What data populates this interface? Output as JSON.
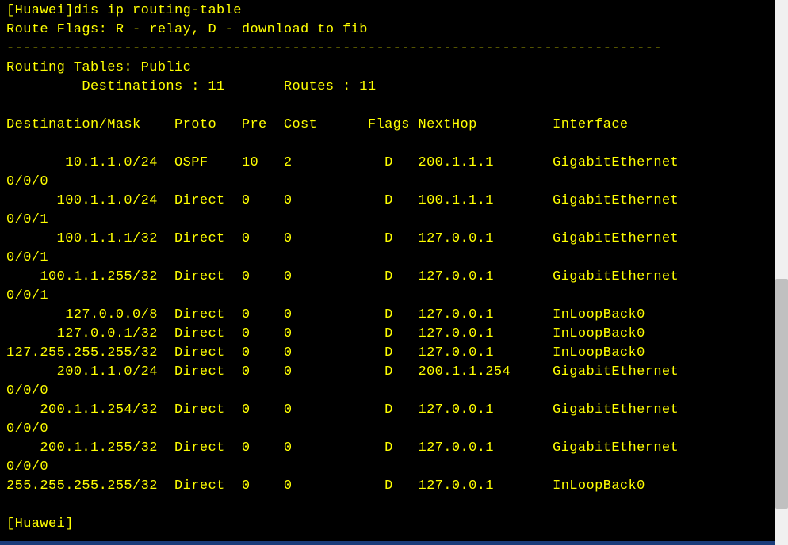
{
  "prompt_host": "[Huawei]",
  "command": "dis ip routing-table",
  "route_flags": "Route Flags: R - relay, D - download to fib",
  "separator": "------------------------------------------------------------------------------",
  "table_name": "Routing Tables: Public",
  "summary": {
    "destinations_label": "Destinations :",
    "destinations_value": "11",
    "routes_label": "Routes :",
    "routes_value": "11"
  },
  "headers": {
    "destmask": "Destination/Mask",
    "proto": "Proto",
    "pre": "Pre",
    "cost": "Cost",
    "flags": "Flags",
    "nexthop": "NextHop",
    "interface": "Interface"
  },
  "routes": [
    {
      "dest": "10.1.1.0/24",
      "proto": "OSPF",
      "pre": "10",
      "cost": "2",
      "flags": "D",
      "nexthop": "200.1.1.1",
      "iface": "GigabitEthernet",
      "iface2": "0/0/0"
    },
    {
      "dest": "100.1.1.0/24",
      "proto": "Direct",
      "pre": "0",
      "cost": "0",
      "flags": "D",
      "nexthop": "100.1.1.1",
      "iface": "GigabitEthernet",
      "iface2": "0/0/1"
    },
    {
      "dest": "100.1.1.1/32",
      "proto": "Direct",
      "pre": "0",
      "cost": "0",
      "flags": "D",
      "nexthop": "127.0.0.1",
      "iface": "GigabitEthernet",
      "iface2": "0/0/1"
    },
    {
      "dest": "100.1.1.255/32",
      "proto": "Direct",
      "pre": "0",
      "cost": "0",
      "flags": "D",
      "nexthop": "127.0.0.1",
      "iface": "GigabitEthernet",
      "iface2": "0/0/1"
    },
    {
      "dest": "127.0.0.0/8",
      "proto": "Direct",
      "pre": "0",
      "cost": "0",
      "flags": "D",
      "nexthop": "127.0.0.1",
      "iface": "InLoopBack0",
      "iface2": ""
    },
    {
      "dest": "127.0.0.1/32",
      "proto": "Direct",
      "pre": "0",
      "cost": "0",
      "flags": "D",
      "nexthop": "127.0.0.1",
      "iface": "InLoopBack0",
      "iface2": ""
    },
    {
      "dest": "127.255.255.255/32",
      "proto": "Direct",
      "pre": "0",
      "cost": "0",
      "flags": "D",
      "nexthop": "127.0.0.1",
      "iface": "InLoopBack0",
      "iface2": ""
    },
    {
      "dest": "200.1.1.0/24",
      "proto": "Direct",
      "pre": "0",
      "cost": "0",
      "flags": "D",
      "nexthop": "200.1.1.254",
      "iface": "GigabitEthernet",
      "iface2": "0/0/0"
    },
    {
      "dest": "200.1.1.254/32",
      "proto": "Direct",
      "pre": "0",
      "cost": "0",
      "flags": "D",
      "nexthop": "127.0.0.1",
      "iface": "GigabitEthernet",
      "iface2": "0/0/0"
    },
    {
      "dest": "200.1.1.255/32",
      "proto": "Direct",
      "pre": "0",
      "cost": "0",
      "flags": "D",
      "nexthop": "127.0.0.1",
      "iface": "GigabitEthernet",
      "iface2": "0/0/0"
    },
    {
      "dest": "255.255.255.255/32",
      "proto": "Direct",
      "pre": "0",
      "cost": "0",
      "flags": "D",
      "nexthop": "127.0.0.1",
      "iface": "InLoopBack0",
      "iface2": ""
    }
  ],
  "prompt_end": "[Huawei]"
}
